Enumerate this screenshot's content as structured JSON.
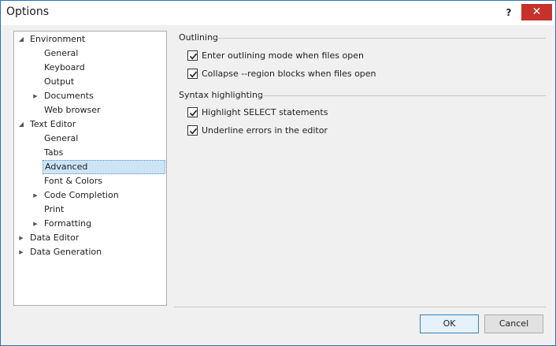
{
  "window": {
    "title": "Options",
    "help_label": "?",
    "close_label": "✕"
  },
  "tree": {
    "items": [
      {
        "label": "Environment",
        "level": 0,
        "expander": "expanded"
      },
      {
        "label": "General",
        "level": 1,
        "expander": "none"
      },
      {
        "label": "Keyboard",
        "level": 1,
        "expander": "none"
      },
      {
        "label": "Output",
        "level": 1,
        "expander": "none"
      },
      {
        "label": "Documents",
        "level": 1,
        "expander": "collapsed"
      },
      {
        "label": "Web browser",
        "level": 1,
        "expander": "none"
      },
      {
        "label": "Text Editor",
        "level": 0,
        "expander": "expanded"
      },
      {
        "label": "General",
        "level": 1,
        "expander": "none"
      },
      {
        "label": "Tabs",
        "level": 1,
        "expander": "none"
      },
      {
        "label": "Advanced",
        "level": 1,
        "expander": "none",
        "selected": true
      },
      {
        "label": "Font & Colors",
        "level": 1,
        "expander": "none"
      },
      {
        "label": "Code Completion",
        "level": 1,
        "expander": "collapsed"
      },
      {
        "label": "Print",
        "level": 1,
        "expander": "none"
      },
      {
        "label": "Formatting",
        "level": 1,
        "expander": "collapsed"
      },
      {
        "label": "Data Editor",
        "level": 0,
        "expander": "collapsed"
      },
      {
        "label": "Data Generation",
        "level": 0,
        "expander": "collapsed"
      }
    ]
  },
  "outlining": {
    "title": "Outlining",
    "options": [
      {
        "label": "Enter outlining mode when files open",
        "checked": true
      },
      {
        "label": "Collapse --region blocks when files open",
        "checked": true
      }
    ]
  },
  "syntax": {
    "title": "Syntax highlighting",
    "options": [
      {
        "label": "Highlight SELECT statements",
        "checked": true
      },
      {
        "label": "Underline errors in the editor",
        "checked": true
      }
    ]
  },
  "buttons": {
    "ok": "OK",
    "cancel": "Cancel"
  },
  "icons": {
    "expanded": "triangle-down-icon",
    "collapsed": "triangle-right-icon",
    "checked": "checkmark-icon"
  },
  "colors": {
    "window_border": "#2f6fb0",
    "close_button": "#c7312d",
    "selection_bg": "#cde4f7",
    "default_button_border": "#3c7fb1"
  }
}
